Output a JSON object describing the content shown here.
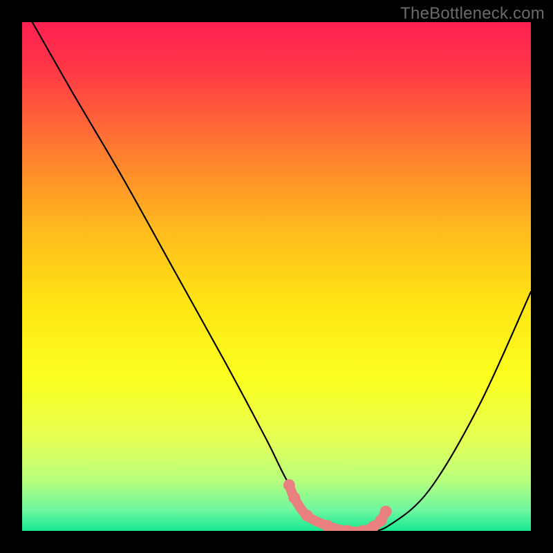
{
  "watermark": "TheBottleneck.com",
  "colors": {
    "frame": "#000000",
    "curve": "#000000",
    "marker": "#e98080",
    "gradient_stops": [
      {
        "offset": 0.0,
        "color": "#ff1f52"
      },
      {
        "offset": 0.1,
        "color": "#ff3a46"
      },
      {
        "offset": 0.25,
        "color": "#ff7b30"
      },
      {
        "offset": 0.4,
        "color": "#ffb81e"
      },
      {
        "offset": 0.55,
        "color": "#ffe414"
      },
      {
        "offset": 0.7,
        "color": "#fbff1f"
      },
      {
        "offset": 0.82,
        "color": "#e6ff55"
      },
      {
        "offset": 0.9,
        "color": "#b8ff7e"
      },
      {
        "offset": 0.96,
        "color": "#6cf7a0"
      },
      {
        "offset": 1.0,
        "color": "#17e893"
      }
    ]
  },
  "chart_data": {
    "type": "line",
    "title": "",
    "xlabel": "",
    "ylabel": "",
    "xlim": [
      0,
      100
    ],
    "ylim": [
      0,
      100
    ],
    "grid": false,
    "series": [
      {
        "name": "bottleneck-curve",
        "x": [
          2,
          10,
          20,
          30,
          40,
          48,
          52,
          56,
          60,
          64,
          68,
          72,
          80,
          90,
          100
        ],
        "values": [
          100,
          86,
          69,
          51,
          33,
          18,
          10,
          4,
          1,
          0,
          0,
          1,
          8,
          25,
          47
        ]
      }
    ],
    "markers": {
      "name": "highlight-points",
      "x": [
        52.5,
        53.5,
        56,
        60,
        64,
        67,
        69,
        70.5,
        71.5
      ],
      "values": [
        9.0,
        6.5,
        3,
        1,
        0,
        0,
        0.8,
        2.0,
        3.8
      ]
    }
  }
}
